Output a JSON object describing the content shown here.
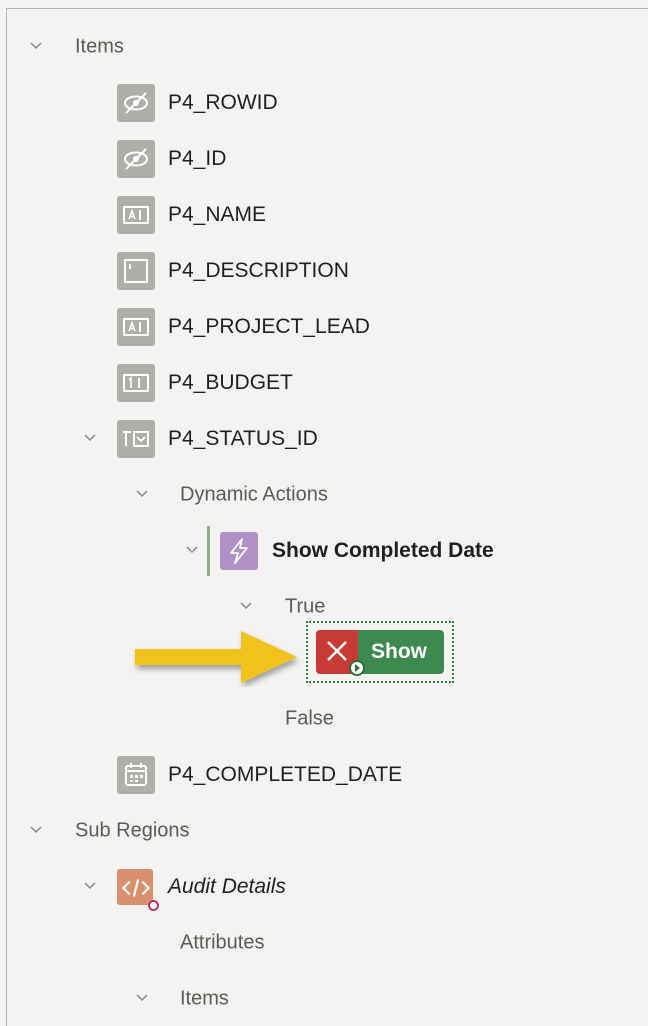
{
  "tree": {
    "items_group": {
      "label": "Items"
    },
    "items": [
      {
        "label": "P4_ROWID",
        "icon": "hidden-item-icon"
      },
      {
        "label": "P4_ID",
        "icon": "hidden-item-icon"
      },
      {
        "label": "P4_NAME",
        "icon": "text-field-icon"
      },
      {
        "label": "P4_DESCRIPTION",
        "icon": "textarea-icon"
      },
      {
        "label": "P4_PROJECT_LEAD",
        "icon": "text-field-icon"
      },
      {
        "label": "P4_BUDGET",
        "icon": "number-field-icon"
      },
      {
        "label": "P4_STATUS_ID",
        "icon": "select-list-icon"
      }
    ],
    "dynamic_actions_group": {
      "label": "Dynamic Actions"
    },
    "dynamic_action": {
      "label": "Show Completed Date",
      "icon": "lightning-icon"
    },
    "true_group": {
      "label": "True"
    },
    "true_action": {
      "label": "Show",
      "icon": "close-icon"
    },
    "false_group": {
      "label": "False"
    },
    "completed_date_item": {
      "label": "P4_COMPLETED_DATE",
      "icon": "date-picker-icon"
    },
    "sub_regions_group": {
      "label": "Sub Regions"
    },
    "sub_region": {
      "label": "Audit Details",
      "icon": "code-region-icon"
    },
    "attributes_node": {
      "label": "Attributes"
    },
    "sub_items_group": {
      "label": "Items"
    }
  },
  "colors": {
    "action_green": "#3c8a4f",
    "action_red": "#c83b34",
    "arrow_yellow": "#f2c21a",
    "dynamic_action_purple": "#b190c8",
    "region_orange": "#d98f6e"
  }
}
